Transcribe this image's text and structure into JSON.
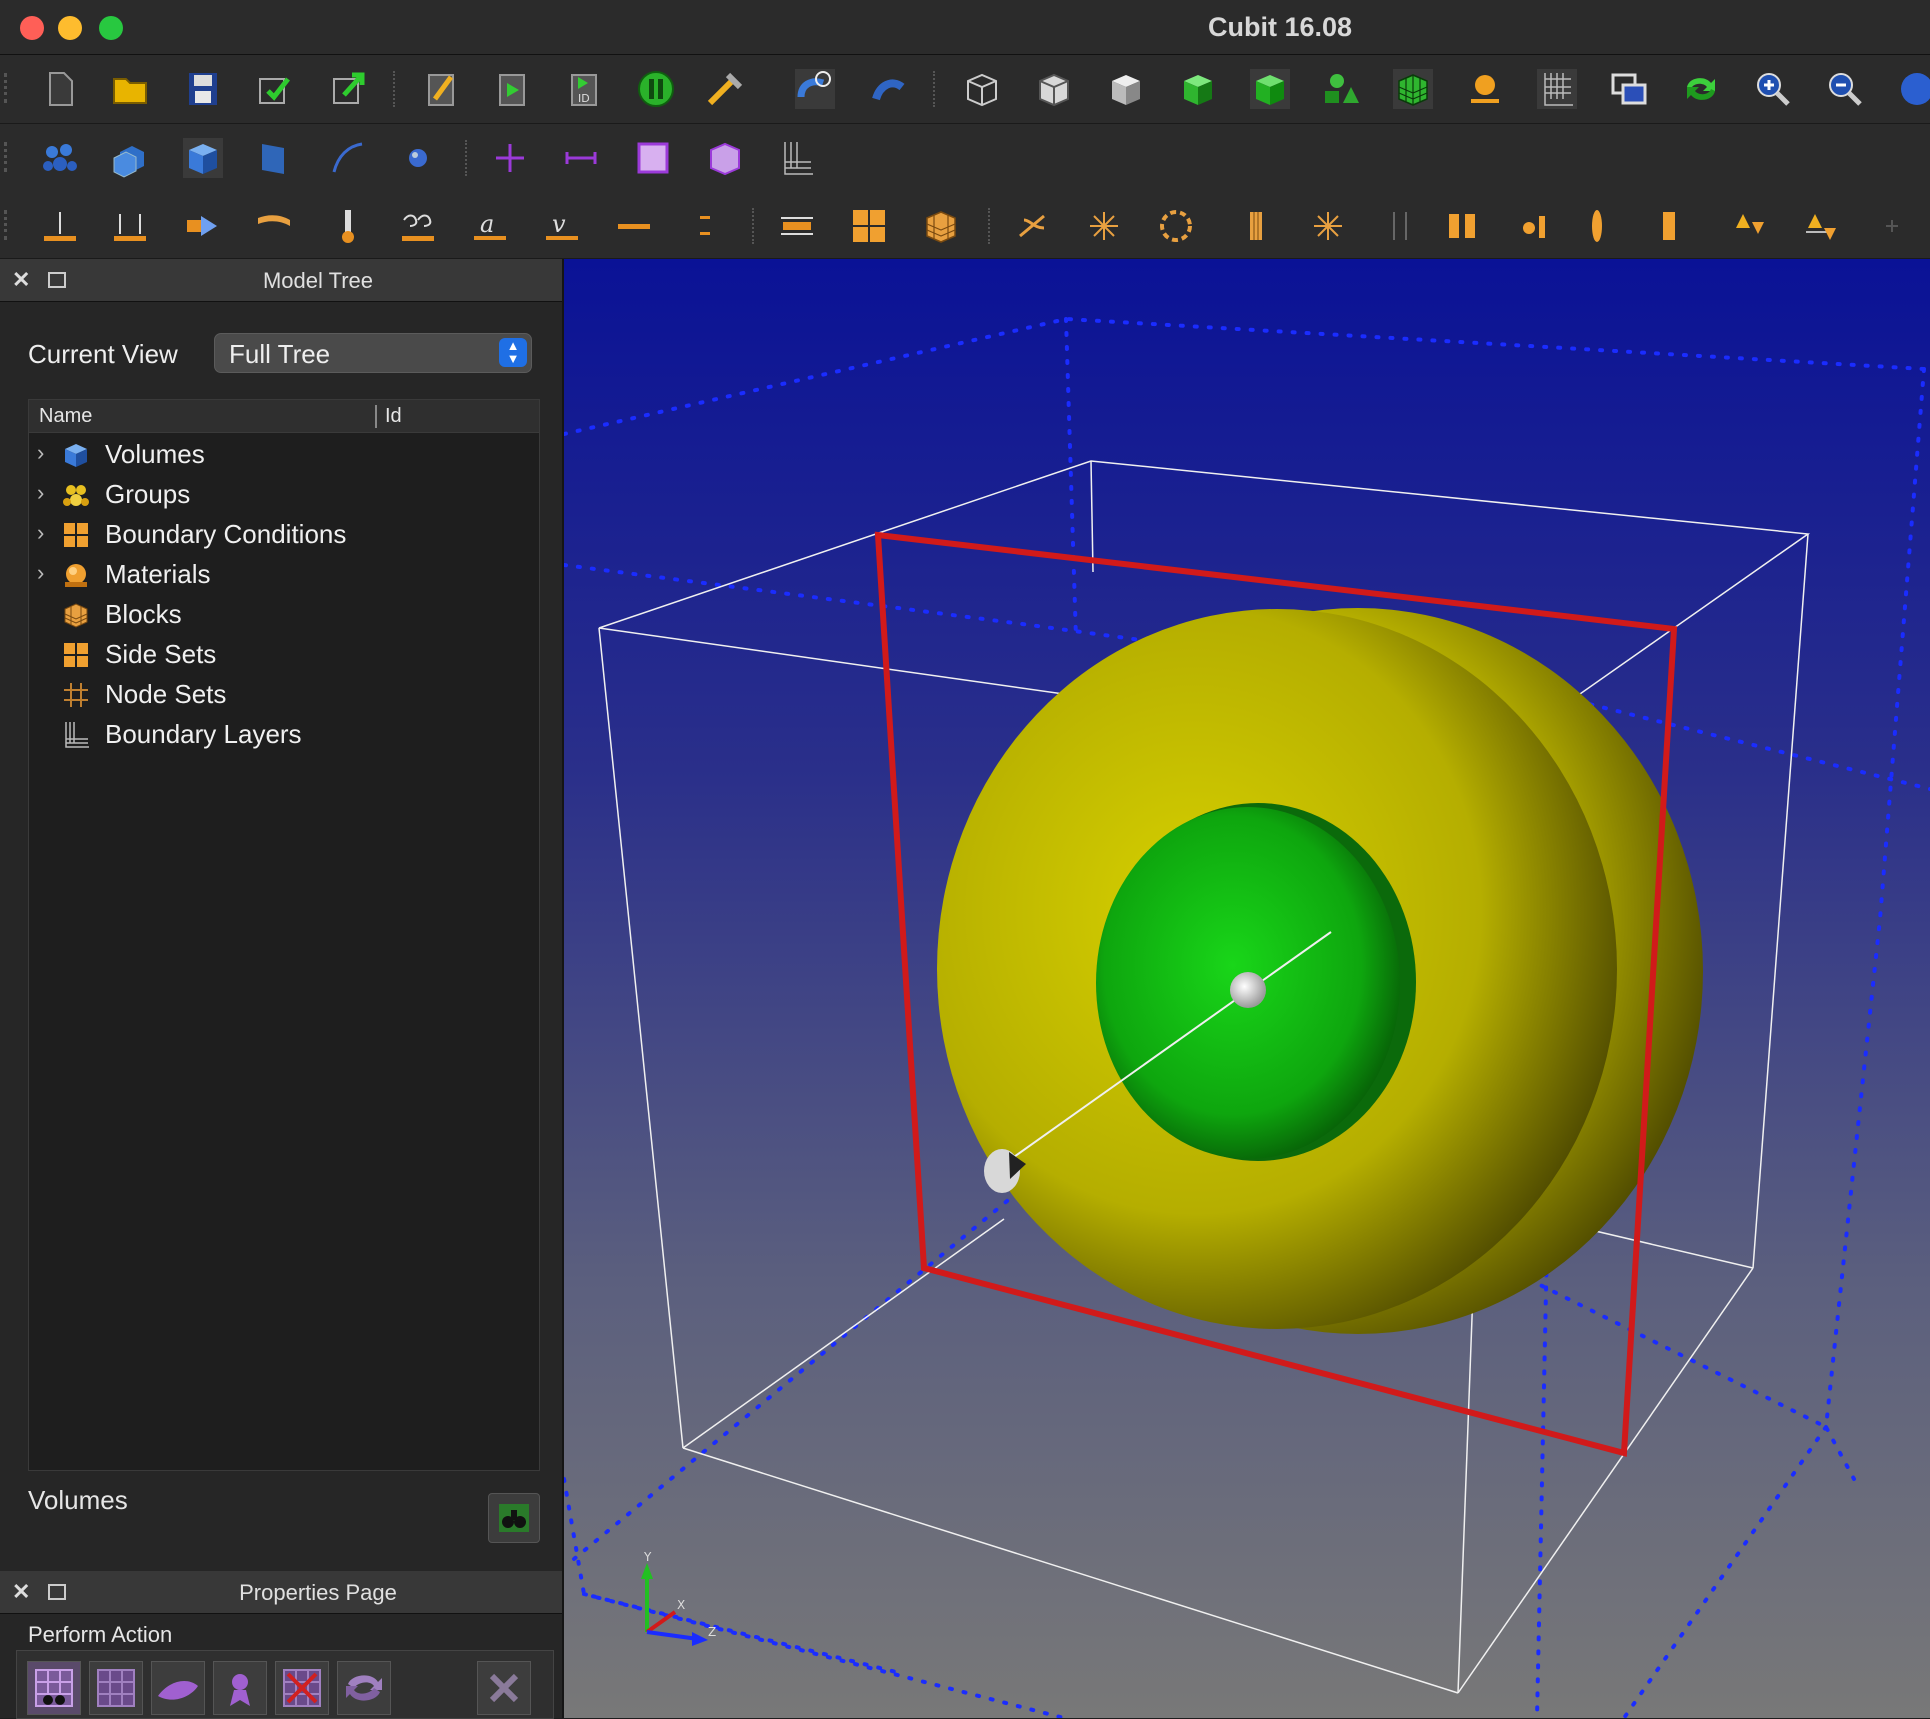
{
  "window": {
    "title": "Cubit 16.08"
  },
  "toolbar_row1": [
    "new-file-icon",
    "open-folder-icon",
    "save-icon",
    "import-icon",
    "export-icon",
    "edit-journal-icon",
    "play-journal-icon",
    "id-icon",
    "pause-icon",
    "tools-icon",
    "undo-toggle-icon",
    "undo-icon",
    "wireframe-cube-icon",
    "hidden-line-cube-icon",
    "shaded-cube-icon",
    "green-cube-icon",
    "green-solid-cube-icon",
    "shapes-icon",
    "mesh-cube-icon",
    "light-icon",
    "grid-icon",
    "window-icon",
    "refresh-icon",
    "zoom-in-icon",
    "zoom-out-icon",
    "globe-icon"
  ],
  "toolbar_row2": [
    "groups-select-icon",
    "multi-volume-icon",
    "volume-select-icon",
    "surface-select-icon",
    "curve-select-icon",
    "vertex-select-icon",
    "node-select-icon",
    "edge-select-icon",
    "face-select-icon",
    "hex-select-icon",
    "boundary-layer-icon"
  ],
  "toolbar_row3": [
    "bc-displacement-icon",
    "bc-force-icon",
    "bc-pressure-icon",
    "bc-heat-flux-icon",
    "bc-temperature-icon",
    "bc-convection-icon",
    "bc-acceleration-icon",
    "bc-velocity-icon",
    "bc-line-icon",
    "bc-line2-icon",
    "bc-contact-icon",
    "bc-sideset-icon",
    "bc-block-icon",
    "bc-fan1-icon",
    "bc-fan2-icon",
    "bc-fan3-icon",
    "bc-column-icon",
    "bc-fan4-icon",
    "bc-split-icon",
    "bc-pause-icon",
    "bc-rigid-icon",
    "bc-ellipse-icon",
    "bc-column2-icon",
    "bc-up-down-icon",
    "bc-up-down2-icon",
    "bc-plus-icon"
  ],
  "model_tree": {
    "title": "Model Tree",
    "current_view_label": "Current View",
    "current_view_value": "Full Tree",
    "columns": {
      "name": "Name",
      "id": "Id"
    },
    "items": [
      {
        "label": "Volumes",
        "icon": "volume-icon",
        "expandable": true
      },
      {
        "label": "Groups",
        "icon": "groups-icon",
        "expandable": true
      },
      {
        "label": "Boundary Conditions",
        "icon": "boundary-conditions-icon",
        "expandable": true
      },
      {
        "label": "Materials",
        "icon": "materials-icon",
        "expandable": true
      },
      {
        "label": "Blocks",
        "icon": "blocks-icon",
        "expandable": false
      },
      {
        "label": "Side Sets",
        "icon": "side-sets-icon",
        "expandable": false
      },
      {
        "label": "Node Sets",
        "icon": "node-sets-icon",
        "expandable": false
      },
      {
        "label": "Boundary Layers",
        "icon": "boundary-layers-icon",
        "expandable": false
      }
    ],
    "footer_label": "Volumes"
  },
  "properties_page": {
    "title": "Properties Page",
    "perform_action_label": "Perform Action"
  },
  "viewport": {
    "axes": {
      "y": "Y",
      "x": "X",
      "z": "Z"
    },
    "colors": {
      "outer_sphere": "#d6d000",
      "inner_sphere": "#19c519",
      "bbox": "#d11a1a",
      "dotted": "#1a2cff"
    }
  }
}
